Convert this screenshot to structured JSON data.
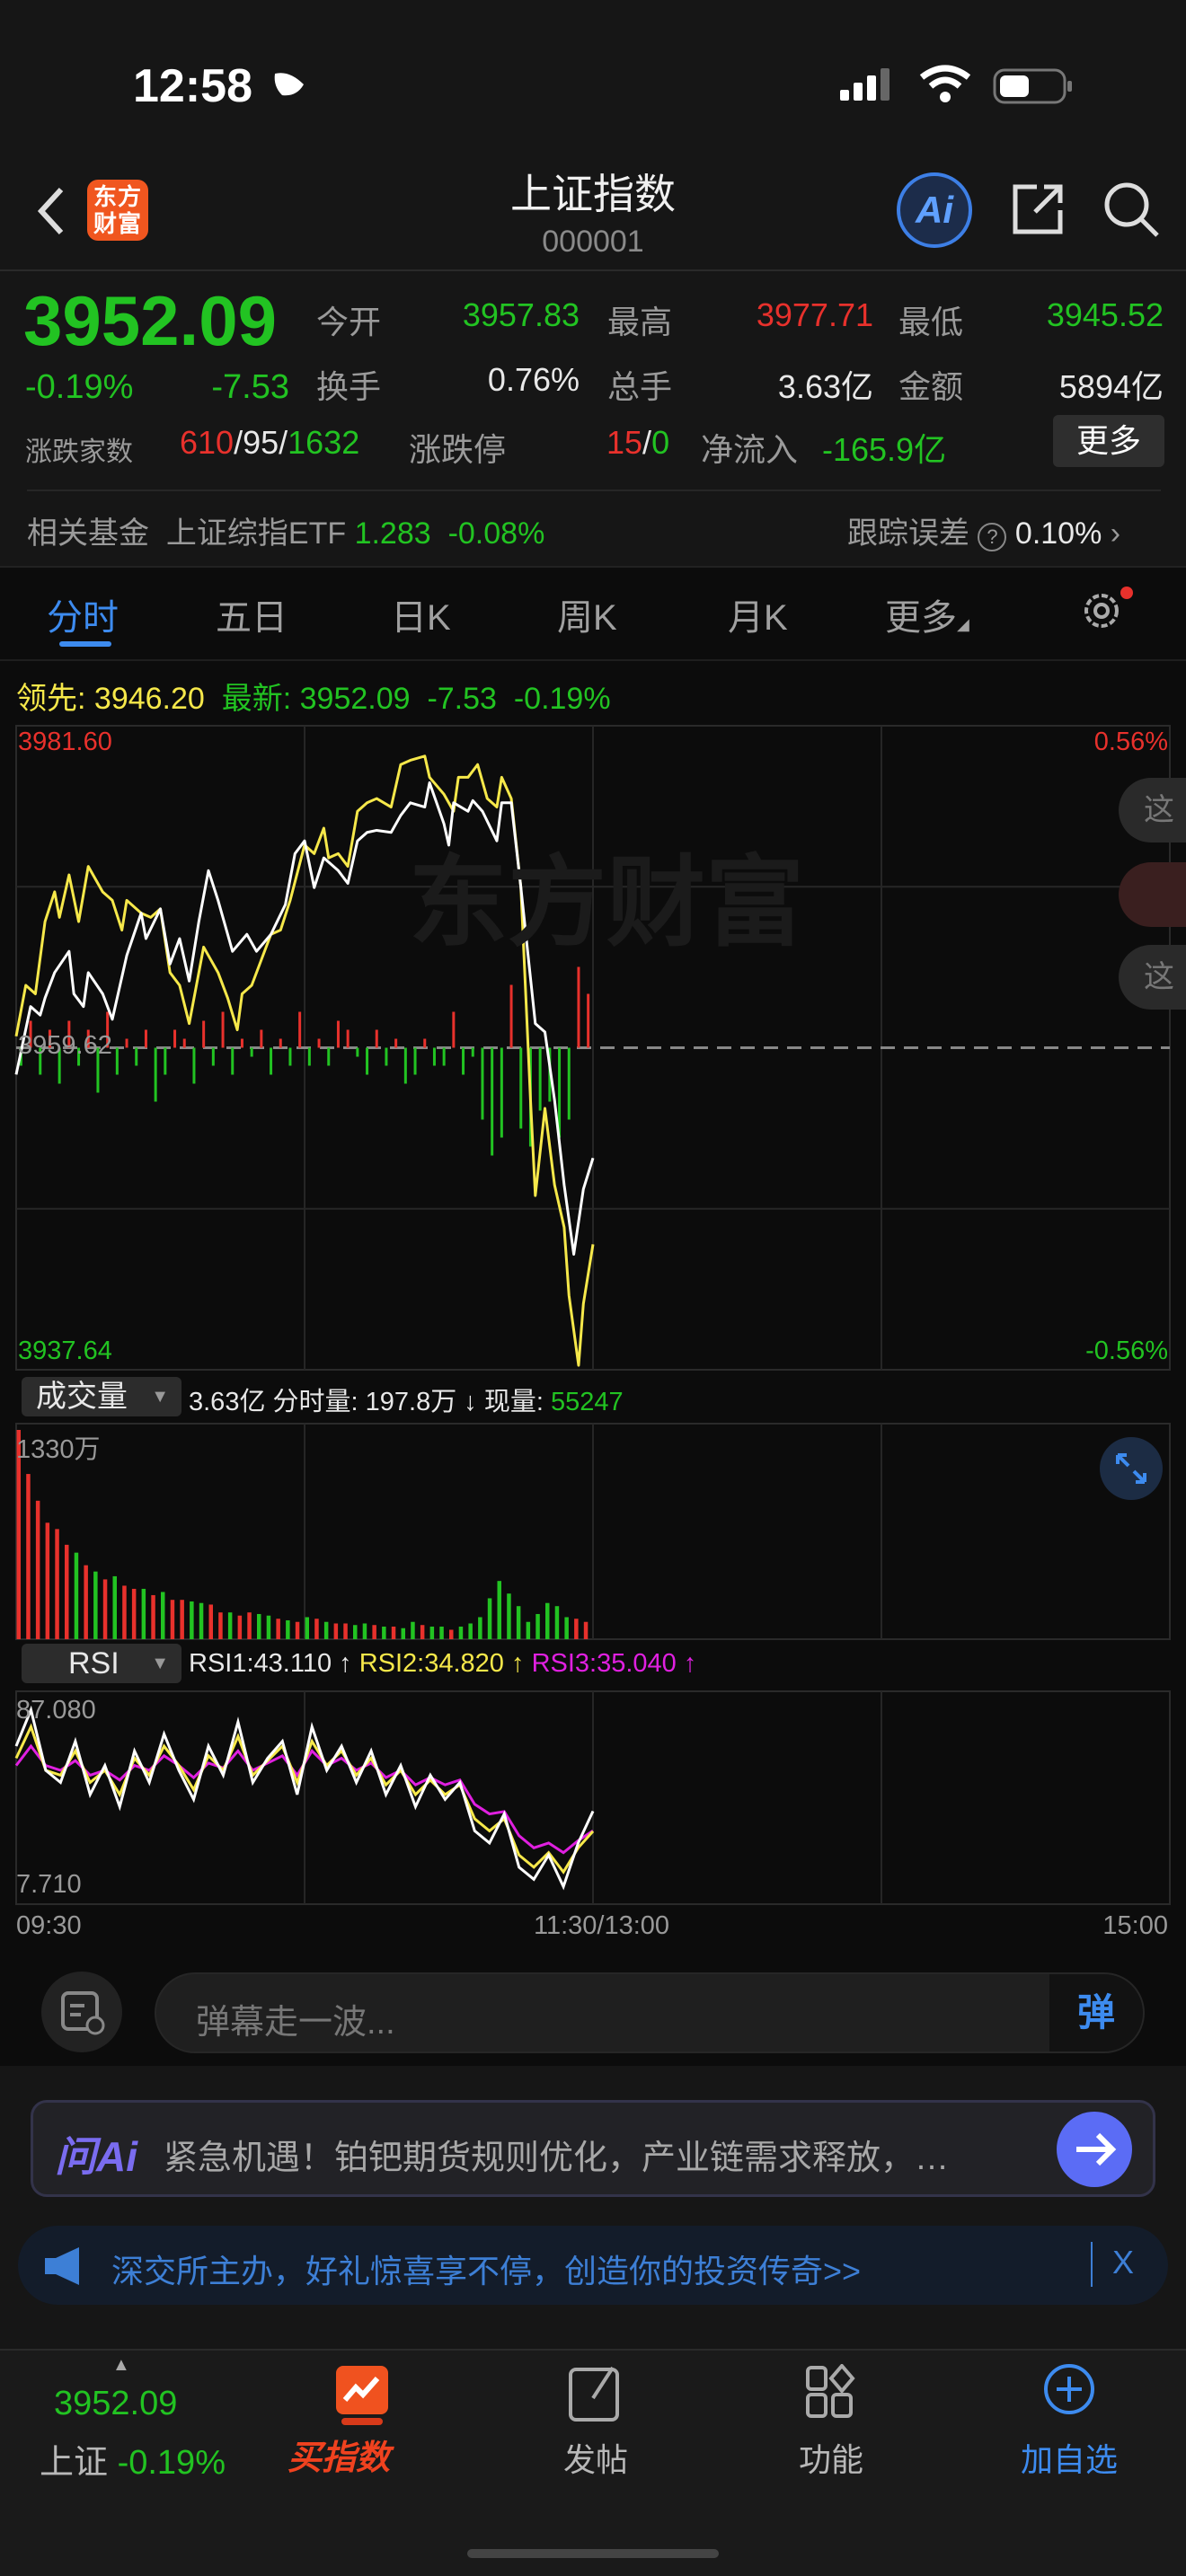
{
  "status": {
    "time": "12:58"
  },
  "header": {
    "logo": "东方财富",
    "title": "上证指数",
    "code": "000001",
    "ai_label": "Ai"
  },
  "quote": {
    "price": "3952.09",
    "pct": "-0.19%",
    "chg": "-7.53",
    "open_label": "今开",
    "open": "3957.83",
    "high_label": "最高",
    "high": "3977.71",
    "low_label": "最低",
    "low": "3945.52",
    "turnover_label": "换手",
    "turnover": "0.76%",
    "vol_label": "总手",
    "vol": "3.63亿",
    "amount_label": "金额",
    "amount": "5894亿",
    "breadth_label": "涨跌家数",
    "up": "610",
    "flat": "95",
    "down": "1632",
    "limit_label": "涨跌停",
    "limit_up": "15",
    "limit_down": "0",
    "flow_label": "净流入",
    "flow": "-165.9亿",
    "more": "更多",
    "sep": "/"
  },
  "fund": {
    "label": "相关基金",
    "name": "上证综指ETF",
    "price": "1.283",
    "pct": "-0.08%",
    "err_label": "跟踪误差",
    "help": "?",
    "err": "0.10%"
  },
  "tabs": [
    {
      "label": "分时"
    },
    {
      "label": "五日"
    },
    {
      "label": "日K"
    },
    {
      "label": "周K"
    },
    {
      "label": "月K"
    },
    {
      "label": "更多"
    }
  ],
  "legend": {
    "lead_label": "领先:",
    "lead": "3946.20",
    "last_label": "最新:",
    "last": "3952.09",
    "chg": "-7.53",
    "pct": "-0.19%"
  },
  "side_pills": [
    "这",
    "",
    "这"
  ],
  "volume_bar": {
    "selector": "成交量",
    "total": "3.63亿",
    "minute_label": "分时量:",
    "minute": "197.8万",
    "arrow": "↓",
    "now_label": "现量:",
    "now": "55247"
  },
  "rsi_bar": {
    "selector": "RSI",
    "rsi1": "RSI1:43.110 ↑",
    "rsi2": "RSI2:34.820 ↑",
    "rsi3": "RSI3:35.040 ↑"
  },
  "danmu": {
    "placeholder": "弹幕走一波...",
    "send": "弹"
  },
  "ai_card": {
    "logo": "问Ai",
    "text": "紧急机遇！铂钯期货规则优化，产业链需求释放，…"
  },
  "ad": {
    "text": "深交所主办，好礼惊喜享不停，创造你的投资传奇>>",
    "close": "X"
  },
  "bottom_nav": {
    "price": "3952.09",
    "name": "上证",
    "pct": "-0.19%",
    "items": [
      {
        "label": "买指数"
      },
      {
        "label": "发帖"
      },
      {
        "label": "功能"
      },
      {
        "label": "加自选"
      }
    ]
  },
  "colors": {
    "up": "#e8312c",
    "down": "#22c322",
    "price_line": "#ffffff",
    "lead_line": "#f6e84a",
    "rsi3": "#e020e0",
    "accent": "#3d8bef"
  },
  "chart_data": [
    {
      "type": "line",
      "title": "分时",
      "watermark": "东方财富",
      "ylim": [
        3937.64,
        3981.6
      ],
      "base": 3959.62,
      "y_labels": {
        "top": "3981.60",
        "base": "3959.62",
        "bottom": "3937.64",
        "top_pct": "0.56%",
        "bottom_pct": "-0.56%"
      },
      "x_ticks": [
        "09:30",
        "11:30/13:00",
        "15:00"
      ],
      "x_range_minutes": [
        0,
        240
      ],
      "series": [
        {
          "name": "最新",
          "color": "#ffffff",
          "points": [
            [
              0,
              3957.79
            ],
            [
              3,
              3962.43
            ],
            [
              5,
              3961.85
            ],
            [
              6,
              3963.01
            ],
            [
              8,
              3964.75
            ],
            [
              11,
              3966.2
            ],
            [
              12,
              3963.3
            ],
            [
              14,
              3962.43
            ],
            [
              15,
              3964.75
            ],
            [
              18,
              3963.3
            ],
            [
              20,
              3961.56
            ],
            [
              23,
              3965.91
            ],
            [
              26,
              3968.81
            ],
            [
              27,
              3967.07
            ],
            [
              30,
              3969.1
            ],
            [
              32,
              3965.33
            ],
            [
              34,
              3967.07
            ],
            [
              36,
              3964.17
            ],
            [
              38,
              3968.23
            ],
            [
              40,
              3971.71
            ],
            [
              42,
              3969.68
            ],
            [
              45,
              3966.2
            ],
            [
              48,
              3967.36
            ],
            [
              50,
              3966.2
            ],
            [
              53,
              3967.36
            ],
            [
              56,
              3969.39
            ],
            [
              58,
              3972.87
            ],
            [
              60,
              3973.74
            ],
            [
              62,
              3970.55
            ],
            [
              64,
              3972.58
            ],
            [
              67,
              3971.71
            ],
            [
              69,
              3970.84
            ],
            [
              71,
              3973.74
            ],
            [
              73,
              3974.32
            ],
            [
              75,
              3974.46
            ],
            [
              78,
              3974.32
            ],
            [
              80,
              3975.48
            ],
            [
              82,
              3976.34
            ],
            [
              85,
              3976.05
            ],
            [
              86,
              3977.71
            ],
            [
              89,
              3974.9
            ],
            [
              90,
              3973.45
            ],
            [
              91,
              3976.34
            ],
            [
              94,
              3975.76
            ],
            [
              95,
              3976.49
            ],
            [
              97,
              3975.76
            ],
            [
              100,
              3973.74
            ],
            [
              101,
              3976.34
            ],
            [
              103,
              3976.34
            ],
            [
              105,
              3970.55
            ],
            [
              108,
              3961.27
            ],
            [
              110,
              3960.69
            ],
            [
              112,
              3956.05
            ],
            [
              114,
              3950.26
            ],
            [
              116,
              3945.52
            ],
            [
              118,
              3949.97
            ],
            [
              120,
              3952.09
            ]
          ]
        },
        {
          "name": "领先",
          "color": "#f6e84a",
          "points": [
            [
              0,
              3960.4
            ],
            [
              2,
              3963.88
            ],
            [
              4,
              3963.3
            ],
            [
              6,
              3968.23
            ],
            [
              8,
              3970.26
            ],
            [
              9,
              3968.52
            ],
            [
              11,
              3971.42
            ],
            [
              13,
              3968.23
            ],
            [
              15,
              3972.0
            ],
            [
              18,
              3970.26
            ],
            [
              20,
              3969.68
            ],
            [
              22,
              3967.65
            ],
            [
              23,
              3969.68
            ],
            [
              26,
              3968.81
            ],
            [
              28,
              3968.52
            ],
            [
              30,
              3969.1
            ],
            [
              32,
              3964.75
            ],
            [
              34,
              3963.88
            ],
            [
              36,
              3961.27
            ],
            [
              39,
              3966.49
            ],
            [
              42,
              3964.75
            ],
            [
              44,
              3963.01
            ],
            [
              46,
              3960.84
            ],
            [
              47,
              3963.3
            ],
            [
              49,
              3963.88
            ],
            [
              51,
              3965.62
            ],
            [
              53,
              3967.36
            ],
            [
              55,
              3967.65
            ],
            [
              57,
              3969.68
            ],
            [
              60,
              3973.45
            ],
            [
              62,
              3972.87
            ],
            [
              64,
              3974.61
            ],
            [
              65,
              3972.58
            ],
            [
              67,
              3972.87
            ],
            [
              69,
              3972.0
            ],
            [
              71,
              3975.76
            ],
            [
              73,
              3976.34
            ],
            [
              75,
              3976.63
            ],
            [
              78,
              3976.05
            ],
            [
              80,
              3978.95
            ],
            [
              82,
              3979.24
            ],
            [
              85,
              3979.53
            ],
            [
              86,
              3978.08
            ],
            [
              89,
              3976.92
            ],
            [
              91,
              3975.76
            ],
            [
              92,
              3978.08
            ],
            [
              94,
              3978.08
            ],
            [
              96,
              3978.95
            ],
            [
              98,
              3976.63
            ],
            [
              100,
              3976.05
            ],
            [
              101,
              3978.08
            ],
            [
              103,
              3976.63
            ],
            [
              105,
              3970.55
            ],
            [
              107,
              3956.05
            ],
            [
              108,
              3949.53
            ],
            [
              110,
              3955.48
            ],
            [
              112,
              3950.26
            ],
            [
              114,
              3947.36
            ],
            [
              115,
              3942.72
            ],
            [
              117,
              3937.94
            ],
            [
              118,
              3942.14
            ],
            [
              120,
              3946.2
            ]
          ]
        }
      ],
      "flow_bars": [
        -2,
        3,
        -3,
        2,
        -4,
        3,
        -2,
        2,
        -5,
        4,
        -3,
        1,
        -2,
        2,
        -6,
        -3,
        2,
        1,
        -4,
        3,
        -2,
        4,
        -3,
        1,
        -1,
        2,
        -3,
        1,
        -2,
        4,
        -2,
        1,
        -2,
        3,
        2,
        -1,
        -3,
        2,
        -2,
        1,
        -4,
        -3,
        1,
        -2,
        -2,
        4,
        -3,
        -1,
        -8,
        -12,
        -10,
        7,
        -9,
        -11,
        -7,
        -6,
        -10,
        -8,
        9,
        6
      ]
    },
    {
      "type": "bar",
      "title": "成交量",
      "unit": "万",
      "ymax": 1330,
      "y_label": "1330万",
      "values": [
        1330,
        1050,
        880,
        740,
        700,
        600,
        550,
        470,
        430,
        380,
        400,
        340,
        320,
        320,
        280,
        300,
        250,
        250,
        240,
        230,
        220,
        170,
        170,
        150,
        170,
        160,
        150,
        130,
        120,
        110,
        140,
        130,
        110,
        100,
        100,
        90,
        100,
        90,
        80,
        80,
        70,
        110,
        90,
        80,
        80,
        60,
        80,
        100,
        140,
        260,
        370,
        290,
        210,
        110,
        160,
        230,
        210,
        140,
        130,
        110
      ],
      "up": [
        1,
        1,
        1,
        1,
        1,
        1,
        -1,
        1,
        -1,
        1,
        -1,
        1,
        1,
        -1,
        1,
        -1,
        1,
        1,
        -1,
        -1,
        1,
        1,
        -1,
        1,
        1,
        -1,
        -1,
        1,
        -1,
        1,
        -1,
        1,
        -1,
        1,
        1,
        -1,
        -1,
        1,
        -1,
        1,
        -1,
        -1,
        1,
        -1,
        -1,
        1,
        -1,
        -1,
        -1,
        -1,
        -1,
        -1,
        -1,
        -1,
        -1,
        -1,
        -1,
        -1,
        1,
        1
      ]
    },
    {
      "type": "line",
      "title": "RSI",
      "ylim": [
        7.71,
        87.08
      ],
      "y_labels": {
        "top": "87.080",
        "bottom": "7.710"
      },
      "series": [
        {
          "name": "RSI1",
          "color": "#ffffff",
          "values": [
            70,
            85,
            60,
            55,
            72,
            50,
            62,
            45,
            68,
            55,
            75,
            60,
            48,
            70,
            58,
            80,
            55,
            65,
            72,
            50,
            78,
            60,
            70,
            55,
            68,
            50,
            62,
            45,
            58,
            48,
            55,
            35,
            30,
            42,
            20,
            15,
            25,
            12,
            30,
            43.11
          ]
        },
        {
          "name": "RSI2",
          "color": "#f6e84a",
          "values": [
            65,
            78,
            60,
            58,
            68,
            55,
            60,
            50,
            65,
            58,
            70,
            62,
            52,
            66,
            60,
            74,
            58,
            64,
            70,
            55,
            72,
            62,
            68,
            58,
            65,
            54,
            60,
            50,
            56,
            50,
            54,
            40,
            35,
            40,
            25,
            20,
            26,
            18,
            28,
            34.82
          ]
        },
        {
          "name": "RSI3",
          "color": "#e020e0",
          "values": [
            62,
            70,
            62,
            60,
            64,
            58,
            60,
            56,
            62,
            60,
            66,
            62,
            57,
            63,
            61,
            68,
            60,
            63,
            66,
            58,
            68,
            62,
            65,
            60,
            63,
            57,
            60,
            54,
            57,
            54,
            56,
            46,
            42,
            43,
            33,
            28,
            30,
            26,
            31,
            35.04
          ]
        }
      ]
    }
  ]
}
